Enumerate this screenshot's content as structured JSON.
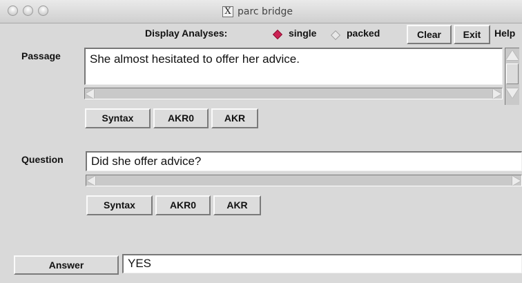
{
  "window": {
    "title": "parc bridge",
    "title_icon": "X",
    "traffic_lights": [
      "close",
      "minimize",
      "zoom"
    ]
  },
  "toolbar": {
    "display_label": "Display Analyses:",
    "options": [
      {
        "label": "single",
        "selected": true
      },
      {
        "label": "packed",
        "selected": false
      }
    ],
    "clear_label": "Clear",
    "exit_label": "Exit",
    "help_label": "Help"
  },
  "passage": {
    "label": "Passage",
    "value": "She almost hesitated to offer her advice.",
    "buttons": [
      "Syntax",
      "AKR0",
      "AKR"
    ]
  },
  "question": {
    "label": "Question",
    "value": "Did she offer advice?",
    "buttons": [
      "Syntax",
      "AKR0",
      "AKR"
    ]
  },
  "answer": {
    "button_label": "Answer",
    "value": "YES"
  },
  "colors": {
    "background": "#d9d9d9",
    "radio_selected": "#cc2255"
  }
}
